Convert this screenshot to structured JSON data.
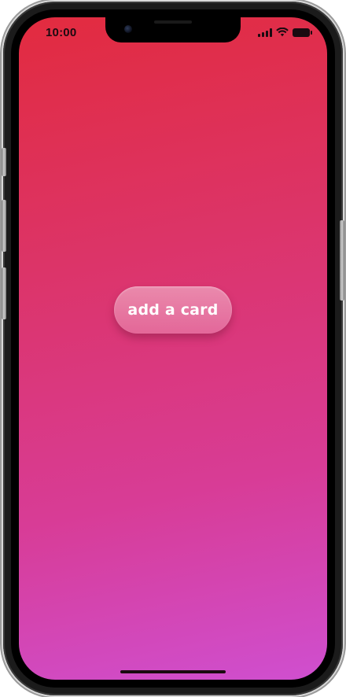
{
  "status_bar": {
    "time": "10:00",
    "icons": [
      "signal-icon",
      "wifi-icon",
      "battery-icon"
    ]
  },
  "main": {
    "add_card_label": "add a card"
  },
  "colors": {
    "gradient_top": "#e22b3f",
    "gradient_bottom": "#cf4fd0",
    "button_text": "#ffffff"
  }
}
